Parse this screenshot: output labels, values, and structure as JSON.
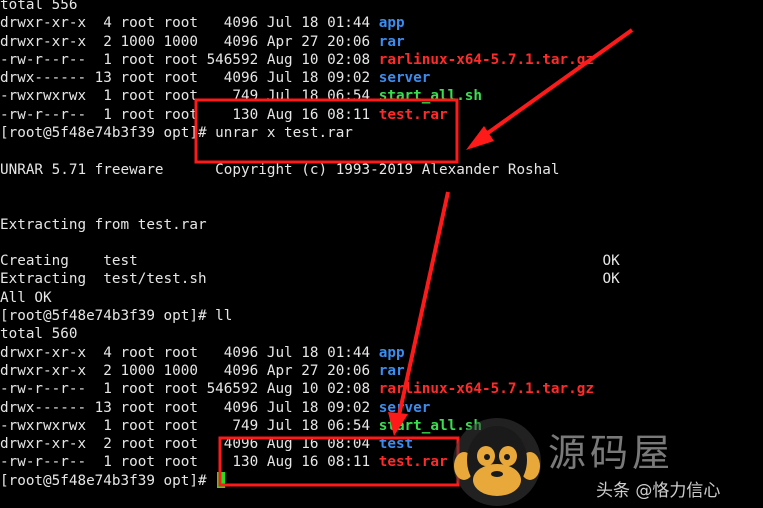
{
  "terminal": {
    "lines": [
      {
        "segments": [
          {
            "text": "total 556",
            "color": "white"
          }
        ]
      },
      {
        "segments": [
          {
            "text": "drwxr-xr-x  4 root root   4096 Jul 18 01:44 ",
            "color": "white"
          },
          {
            "text": "app",
            "color": "blue"
          }
        ]
      },
      {
        "segments": [
          {
            "text": "drwxr-xr-x  2 1000 1000   4096 Apr 27 20:06 ",
            "color": "white"
          },
          {
            "text": "rar",
            "color": "blue"
          }
        ]
      },
      {
        "segments": [
          {
            "text": "-rw-r--r--  1 root root 546592 Aug 10 02:08 ",
            "color": "white"
          },
          {
            "text": "rarlinux-x64-5.7.1.tar.gz",
            "color": "red"
          }
        ]
      },
      {
        "segments": [
          {
            "text": "drwx------ 13 root root   4096 Jul 18 09:02 ",
            "color": "white"
          },
          {
            "text": "server",
            "color": "blue"
          }
        ]
      },
      {
        "segments": [
          {
            "text": "-rwxrwxrwx  1 root root    749 Jul 18 06:54 ",
            "color": "white"
          },
          {
            "text": "start_all.sh",
            "color": "green"
          }
        ]
      },
      {
        "segments": [
          {
            "text": "-rw-r--r--  1 root root    130 Aug 16 08:11 ",
            "color": "white"
          },
          {
            "text": "test.rar",
            "color": "red"
          }
        ]
      },
      {
        "segments": [
          {
            "text": "[root@5f48e74b3f39 opt]# unrar x test.rar",
            "color": "white"
          }
        ]
      },
      {
        "segments": [
          {
            "text": "",
            "color": "white"
          }
        ]
      },
      {
        "segments": [
          {
            "text": "UNRAR 5.71 freeware      Copyright (c) 1993-2019 Alexander Roshal",
            "color": "white"
          }
        ]
      },
      {
        "segments": [
          {
            "text": "",
            "color": "white"
          }
        ]
      },
      {
        "segments": [
          {
            "text": "",
            "color": "white"
          }
        ]
      },
      {
        "segments": [
          {
            "text": "Extracting from test.rar",
            "color": "white"
          }
        ]
      },
      {
        "segments": [
          {
            "text": "",
            "color": "white"
          }
        ]
      },
      {
        "segments": [
          {
            "text": "Creating    test                                                      OK",
            "color": "white"
          }
        ]
      },
      {
        "segments": [
          {
            "text": "Extracting  test/test.sh                                              OK",
            "color": "white"
          }
        ]
      },
      {
        "segments": [
          {
            "text": "All OK",
            "color": "white"
          }
        ]
      },
      {
        "segments": [
          {
            "text": "[root@5f48e74b3f39 opt]# ll",
            "color": "white"
          }
        ]
      },
      {
        "segments": [
          {
            "text": "total 560",
            "color": "white"
          }
        ]
      },
      {
        "segments": [
          {
            "text": "drwxr-xr-x  4 root root   4096 Jul 18 01:44 ",
            "color": "white"
          },
          {
            "text": "app",
            "color": "blue"
          }
        ]
      },
      {
        "segments": [
          {
            "text": "drwxr-xr-x  2 1000 1000   4096 Apr 27 20:06 ",
            "color": "white"
          },
          {
            "text": "rar",
            "color": "blue"
          }
        ]
      },
      {
        "segments": [
          {
            "text": "-rw-r--r--  1 root root 546592 Aug 10 02:08 ",
            "color": "white"
          },
          {
            "text": "rarlinux-x64-5.7.1.tar.gz",
            "color": "red"
          }
        ]
      },
      {
        "segments": [
          {
            "text": "drwx------ 13 root root   4096 Jul 18 09:02 ",
            "color": "white"
          },
          {
            "text": "server",
            "color": "blue"
          }
        ]
      },
      {
        "segments": [
          {
            "text": "-rwxrwxrwx  1 root root    749 Jul 18 06:54 ",
            "color": "white"
          },
          {
            "text": "start_all.sh",
            "color": "green"
          }
        ]
      },
      {
        "segments": [
          {
            "text": "drwxr-xr-x  2 root root   4096 Aug 16 08:04 ",
            "color": "white"
          },
          {
            "text": "test",
            "color": "blue"
          }
        ]
      },
      {
        "segments": [
          {
            "text": "-rw-r--r--  1 root root    130 Aug 16 08:11 ",
            "color": "white"
          },
          {
            "text": "test.rar",
            "color": "red"
          }
        ]
      },
      {
        "segments": [
          {
            "text": "[root@5f48e74b3f39 opt]# ",
            "color": "white"
          }
        ],
        "cursor": true
      }
    ]
  },
  "colors": {
    "background": "#000000",
    "text": "#e6e6e6",
    "directory": "#3b8df0",
    "archive": "#ff2a2a",
    "executable": "#38e050",
    "cursor": "#22e022",
    "annotation": "#ff1a1a"
  },
  "annotations": {
    "boxes": [
      "command-box",
      "listing-box"
    ],
    "arrows": [
      "arrow-upper",
      "arrow-lower"
    ]
  },
  "watermark": {
    "title": "源码屋",
    "subtitle": "头条 @恪力信心",
    "logo_icon": "monkey-logo-icon"
  }
}
